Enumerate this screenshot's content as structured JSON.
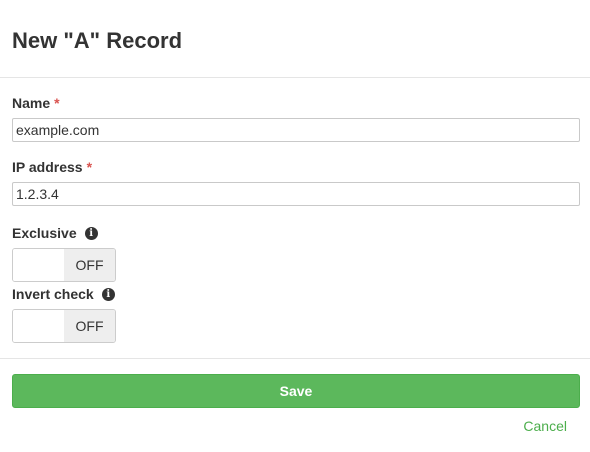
{
  "dialog": {
    "title": "New \"A\" Record"
  },
  "form": {
    "name": {
      "label": "Name",
      "required_mark": "*",
      "value": "example.com"
    },
    "ip_address": {
      "label": "IP address",
      "required_mark": "*",
      "value": "1.2.3.4"
    },
    "exclusive": {
      "label": "Exclusive",
      "info_icon": "info-circle-icon",
      "state_label": "OFF",
      "checked": false
    },
    "invert_check": {
      "label": "Invert check",
      "info_icon": "info-circle-icon",
      "state_label": "OFF",
      "checked": false
    }
  },
  "actions": {
    "save_label": "Save",
    "cancel_label": "Cancel"
  },
  "colors": {
    "save_button": "#5cb85c",
    "cancel_link": "#4cae4c",
    "required_mark": "#d9534f"
  }
}
